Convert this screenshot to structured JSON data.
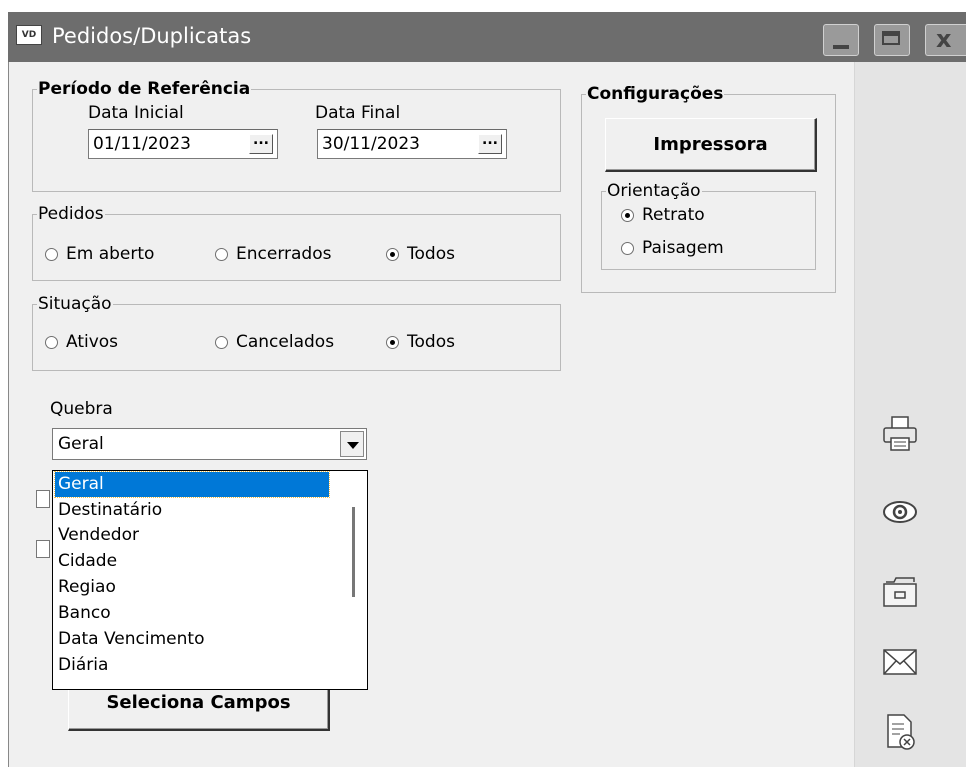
{
  "window": {
    "title": "Pedidos/Duplicatas",
    "icon_text": "VD"
  },
  "periodo": {
    "legend": "Período de Referência",
    "data_inicial_label": "Data Inicial",
    "data_inicial_value": "01/11/2023",
    "data_final_label": "Data Final",
    "data_final_value": "30/11/2023",
    "dots": "..."
  },
  "configuracoes": {
    "legend": "Configurações",
    "impressora_button": "Impressora",
    "orientacao_legend": "Orientação",
    "orientacao_options": [
      {
        "label": "Retrato",
        "selected": true
      },
      {
        "label": "Paisagem",
        "selected": false
      }
    ]
  },
  "pedidos": {
    "legend": "Pedidos",
    "options": [
      {
        "label": "Em aberto",
        "selected": false
      },
      {
        "label": "Encerrados",
        "selected": false
      },
      {
        "label": "Todos",
        "selected": true
      }
    ]
  },
  "situacao": {
    "legend": "Situação",
    "options": [
      {
        "label": "Ativos",
        "selected": false
      },
      {
        "label": "Cancelados",
        "selected": false
      },
      {
        "label": "Todos",
        "selected": true
      }
    ]
  },
  "quebra": {
    "label": "Quebra",
    "selected": "Geral",
    "options": [
      "Geral",
      "Destinatário",
      "Vendedor",
      "Cidade",
      "Regiao",
      "Banco",
      "Data Vencimento",
      "Diária"
    ]
  },
  "seleciona_campos_button": "Seleciona Campos",
  "side_icons": [
    "printer-icon",
    "eye-icon",
    "folder-icon",
    "envelope-icon",
    "document-close-icon"
  ]
}
